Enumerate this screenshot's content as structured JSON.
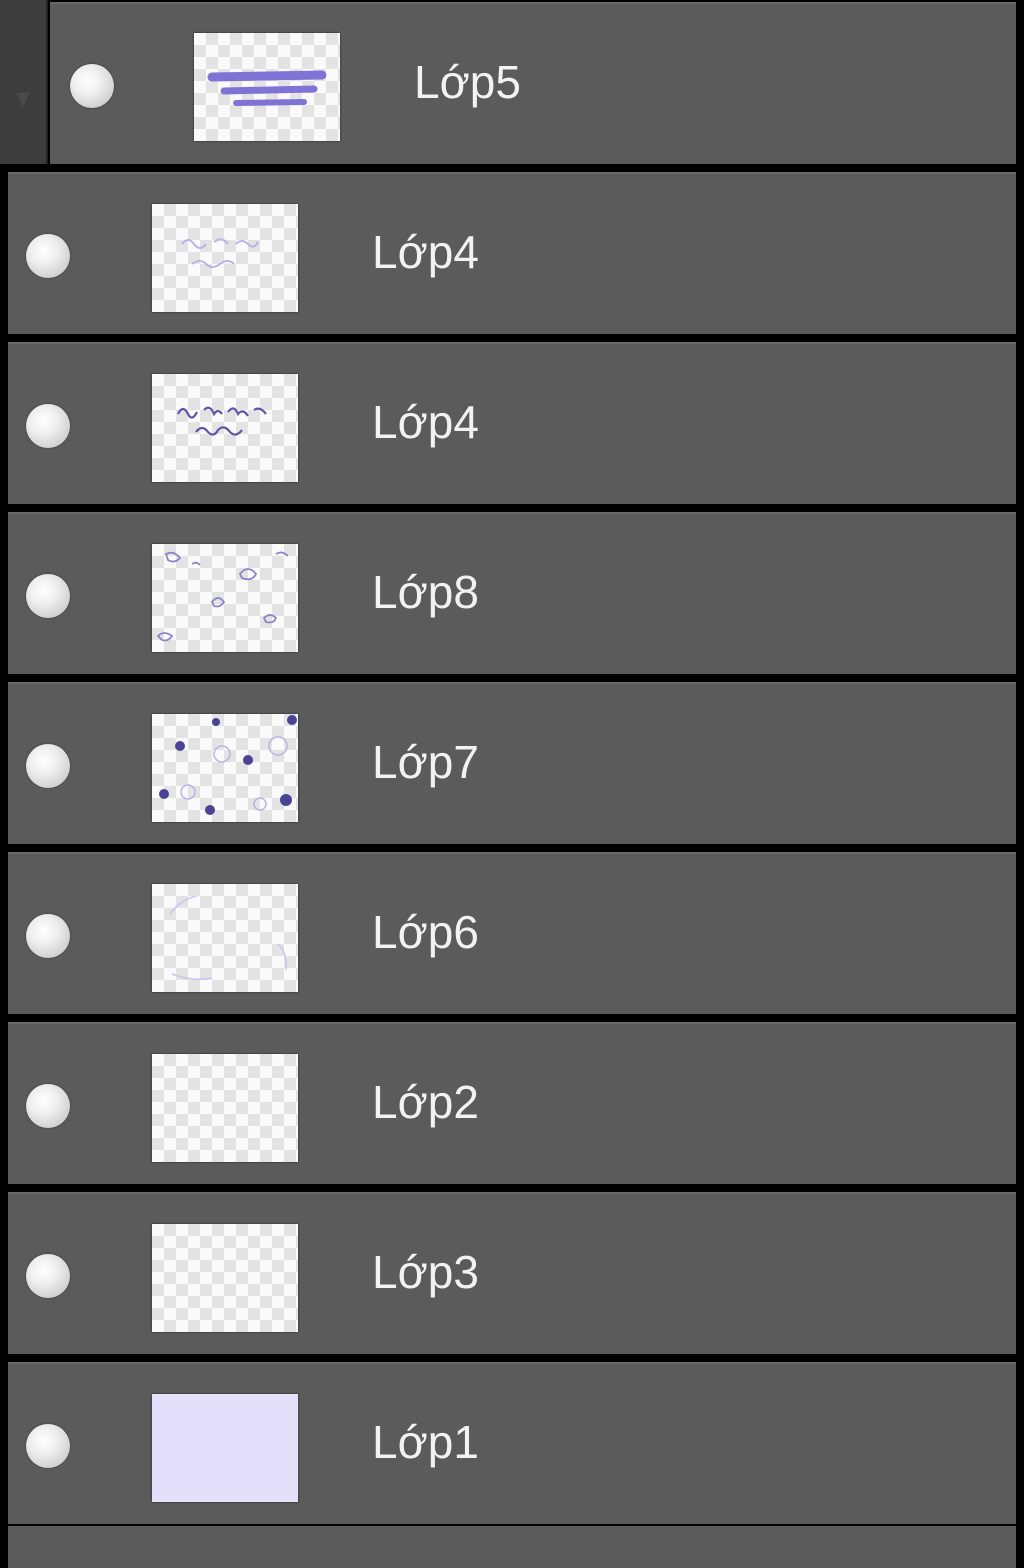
{
  "layers_panel": {
    "selected_fill": "#5b5b5b",
    "layers": [
      {
        "name": "Lớp5",
        "thumb_icon": "stroke-thumb",
        "in_group": true
      },
      {
        "name": "Lớp4",
        "thumb_icon": "faint-text-thumb",
        "in_group": false
      },
      {
        "name": "Lớp4",
        "thumb_icon": "text-thumb",
        "in_group": false
      },
      {
        "name": "Lớp8",
        "thumb_icon": "doodle-thumb",
        "in_group": false
      },
      {
        "name": "Lớp7",
        "thumb_icon": "dots-thumb",
        "in_group": false
      },
      {
        "name": "Lớp6",
        "thumb_icon": "faint-lines-thumb",
        "in_group": false
      },
      {
        "name": "Lớp2",
        "thumb_icon": "empty-thumb",
        "in_group": false
      },
      {
        "name": "Lớp3",
        "thumb_icon": "empty-thumb",
        "in_group": false
      },
      {
        "name": "Lớp1",
        "thumb_icon": "fill-thumb",
        "in_group": false,
        "fill_color": "#e4e0fb"
      }
    ],
    "accent_color": "#7f73d6"
  }
}
